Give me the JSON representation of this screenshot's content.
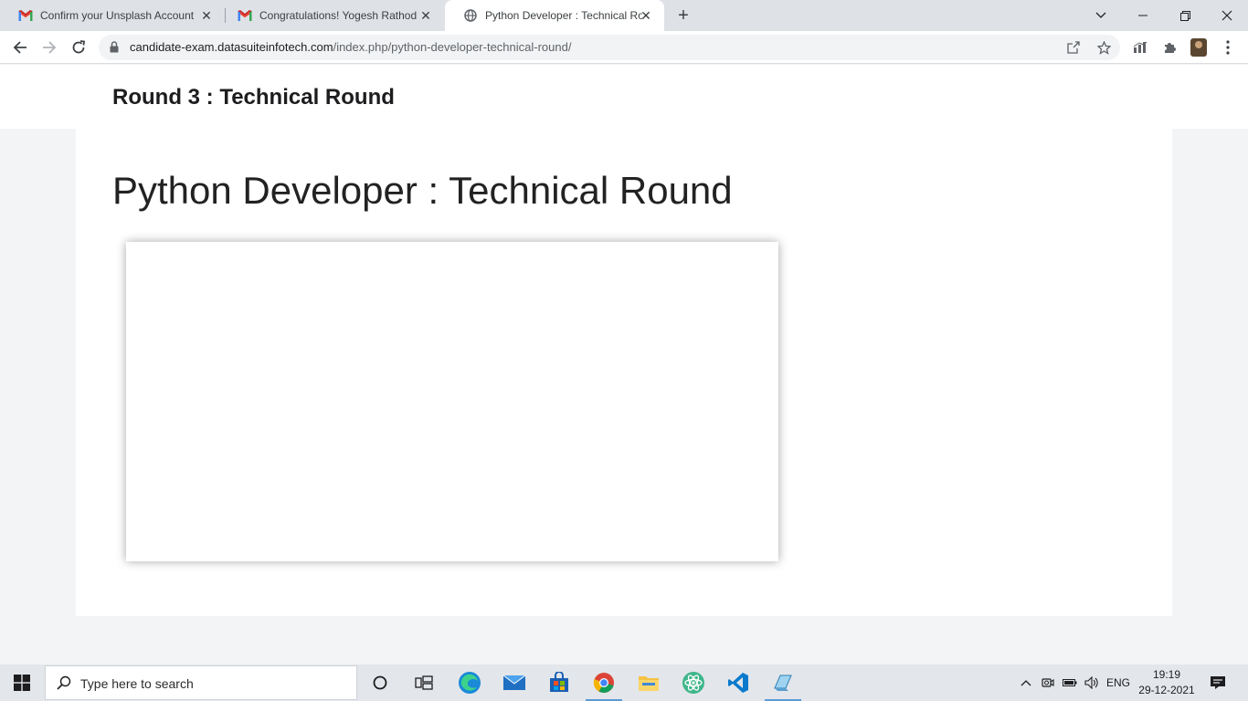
{
  "browser": {
    "tabs": [
      {
        "title": "Confirm your Unsplash Account",
        "favicon": "gmail-icon",
        "active": false
      },
      {
        "title": "Congratulations! Yogesh Rathod",
        "favicon": "gmail-icon",
        "active": false
      },
      {
        "title": "Python Developer : Technical Rou",
        "favicon": "globe-icon",
        "active": true
      }
    ],
    "url_host": "candidate-exam.datasuiteinfotech.com",
    "url_path": "/index.php/python-developer-technical-round/"
  },
  "page": {
    "header_title": "Round 3 : Technical Round",
    "main_title": "Python Developer : Technical Round"
  },
  "taskbar": {
    "search_placeholder": "Type here to search",
    "language": "ENG",
    "time": "19:19",
    "date": "29-12-2021"
  },
  "colors": {
    "accent": "#1a73e8",
    "taskbar_bg": "#e3e6ea",
    "page_bg": "#f3f4f6"
  }
}
